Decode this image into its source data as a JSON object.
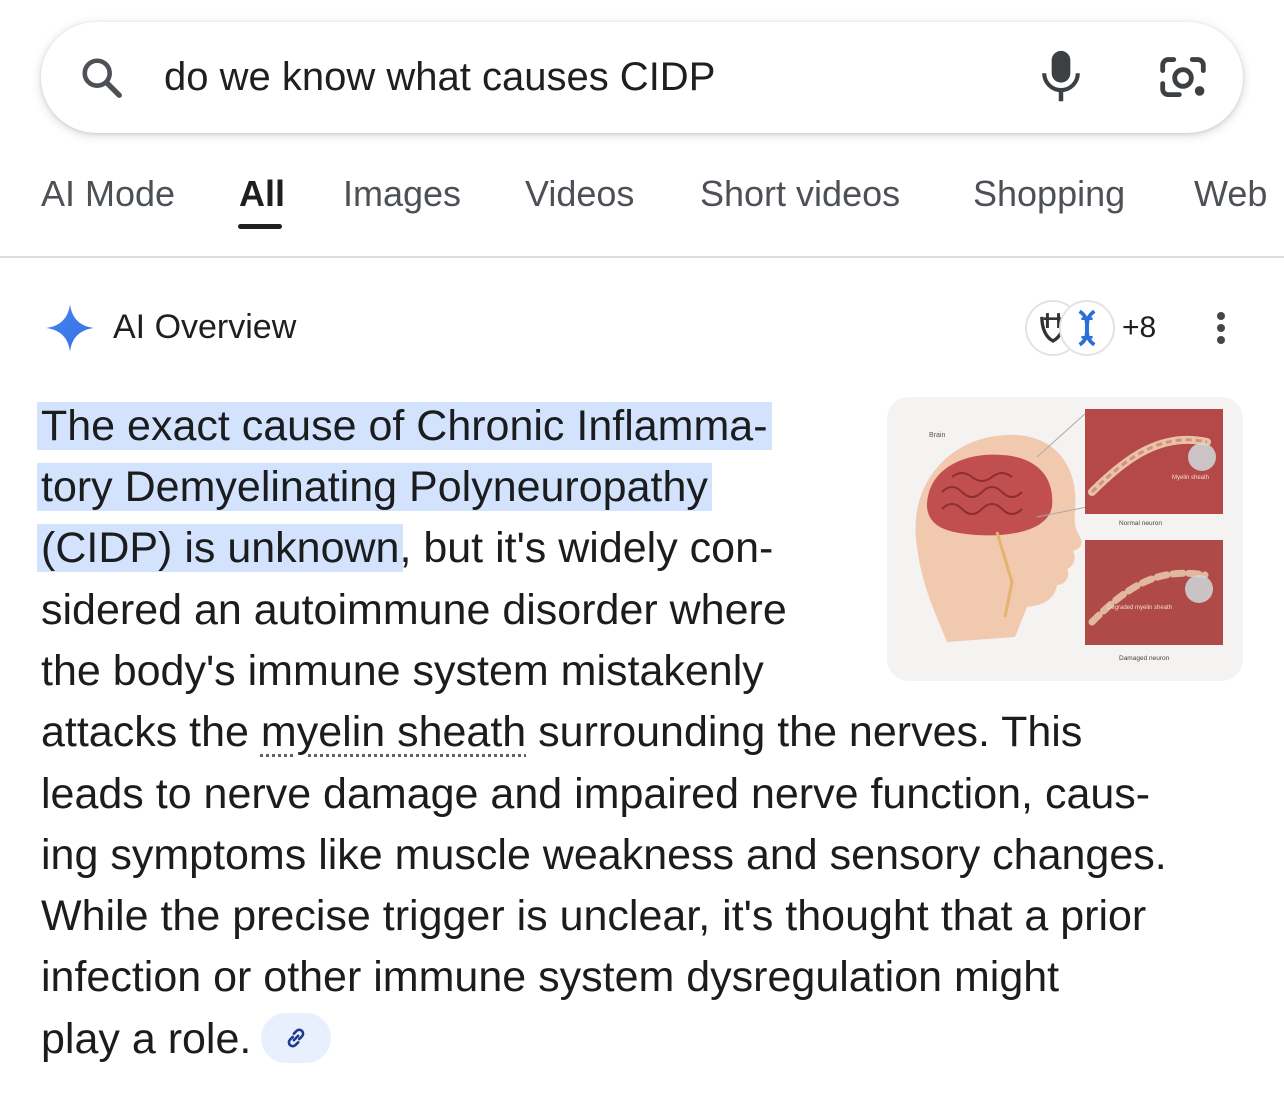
{
  "search": {
    "query": "do we know what causes CIDP"
  },
  "tabs": [
    {
      "label": "AI Mode"
    },
    {
      "label": "All"
    },
    {
      "label": "Images"
    },
    {
      "label": "Videos"
    },
    {
      "label": "Short videos"
    },
    {
      "label": "Shopping"
    },
    {
      "label": "Web"
    }
  ],
  "active_tab": "All",
  "ai_overview": {
    "title": "AI Overview",
    "more_sources": "+8",
    "image_labels": {
      "brain": "Brain",
      "normal": "Normal neuron",
      "damaged": "Damaged neuron",
      "myelin": "Myelin sheath",
      "degraded": "Degraded myelin sheath"
    },
    "lines": {
      "l1": "The exact cause of Chronic Inflamma-",
      "l2": "tory Demyelinating Polyneuropathy",
      "l3_hl": "(CIDP) is unknown",
      "l3_rest": ", but it's widely con-",
      "l4": "sidered an autoimmune disorder where",
      "l5": "the body's immune system mistakenly",
      "l6_a": "attacks the ",
      "l6_link": "myelin sheath",
      "l6_b": " surrounding the nerves. This",
      "l7": "leads to nerve damage and impaired nerve function, caus-",
      "l8": "ing symptoms like muscle weakness and sensory changes.",
      "l9": "While the precise trigger is unclear, it's thought that a prior",
      "l10": "infection or other immune system dysregulation might",
      "l11": "play a role."
    }
  },
  "colors": {
    "highlight": "#d3e3fd",
    "gemini_blue": "#4285f4",
    "text": "#1b1c1e",
    "tab_text": "#4d5156"
  }
}
